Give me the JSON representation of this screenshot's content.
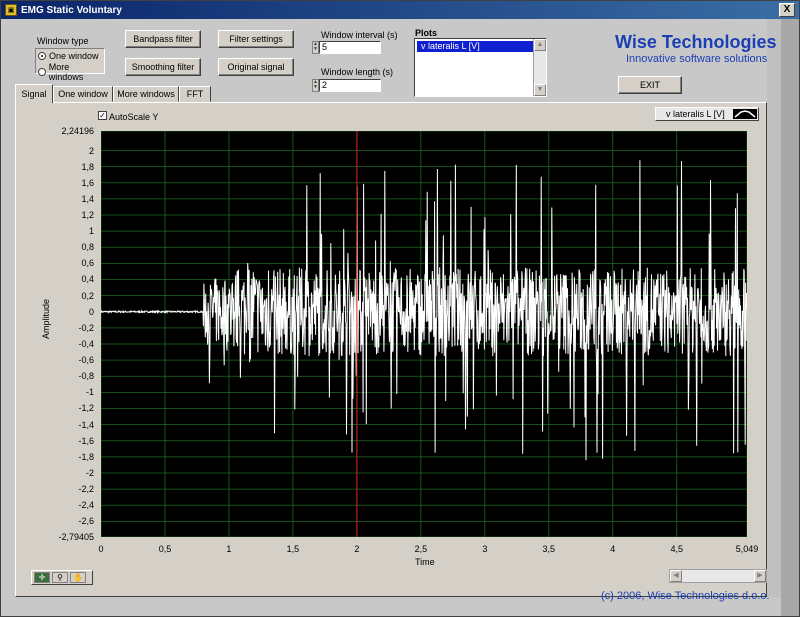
{
  "window": {
    "title": "EMG Static Voluntary",
    "close_label": "X"
  },
  "controls": {
    "window_type_label": "Window type",
    "radio_options": [
      {
        "label": "One window",
        "selected": true
      },
      {
        "label": "More windows",
        "selected": false
      }
    ],
    "bandpass_label": "Bandpass filter",
    "smoothing_label": "Smoothing filter",
    "filter_settings_label": "Filter settings",
    "original_signal_label": "Original signal",
    "window_interval_label": "Window interval (s)",
    "window_interval_value": "5",
    "window_length_label": "Window length (s)",
    "window_length_value": "2",
    "plots_label": "Plots",
    "plots_items": [
      "v  lateralis L [V]"
    ],
    "exit_label": "EXIT"
  },
  "brand": {
    "name": "Wise Technologies",
    "tagline": "Innovative software solutions",
    "color": "#1a3fb4"
  },
  "tabs": [
    {
      "label": "Signal",
      "active": true
    },
    {
      "label": "One window",
      "active": false
    },
    {
      "label": "More windows",
      "active": false
    },
    {
      "label": "FFT",
      "active": false
    }
  ],
  "graph": {
    "autoscale_label": "AutoScale Y",
    "autoscale_checked": true,
    "legend_label": "v  lateralis L [V]",
    "cursor_x": 2
  },
  "chart_data": {
    "type": "line",
    "title": "",
    "xlabel": "Time",
    "ylabel": "Amplitude",
    "xlim": [
      0,
      5.049
    ],
    "ylim": [
      -2.79405,
      2.24196
    ],
    "x_ticks": [
      "0",
      "0,5",
      "1",
      "1,5",
      "2",
      "2,5",
      "3",
      "3,5",
      "4",
      "4,5",
      "5,049"
    ],
    "y_ticks": [
      "2,24196",
      "2",
      "1,8",
      "1,6",
      "1,4",
      "1,2",
      "1",
      "0,8",
      "0,6",
      "0,4",
      "0,2",
      "0",
      "-0,2",
      "-0,4",
      "-0,6",
      "-0,8",
      "-1",
      "-1,2",
      "-1,4",
      "-1,6",
      "-1,8",
      "-2",
      "-2,2",
      "-2,4",
      "-2,6",
      "-2,79405"
    ],
    "grid": true,
    "series": [
      {
        "name": "v  lateralis L [V]",
        "color": "#ffffff"
      }
    ],
    "signal_onset": 0.8
  },
  "footer": {
    "copyright": "(c) 2006, Wise Technologies d.o.o."
  },
  "icons": {
    "palette": [
      "crosshair-icon",
      "zoom-icon",
      "pan-hand-icon"
    ]
  }
}
